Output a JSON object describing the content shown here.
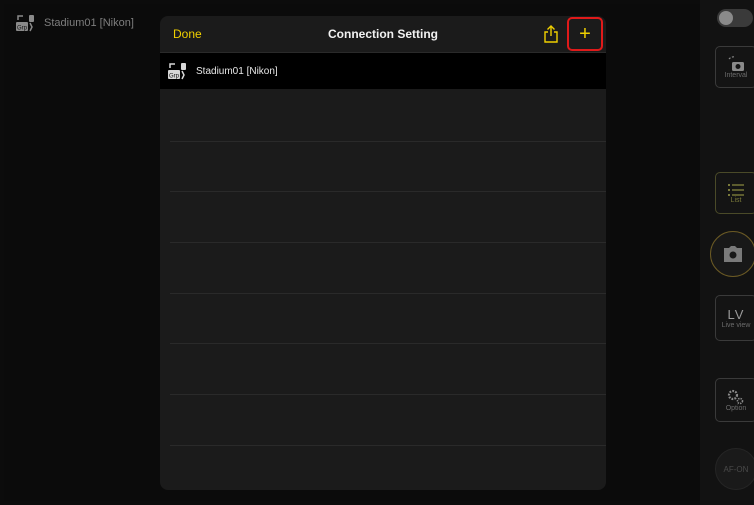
{
  "background": {
    "connection_name": "Stadium01 [Nikon]",
    "grp_badge": "Grp"
  },
  "modal": {
    "done_label": "Done",
    "title": "Connection Setting",
    "add_label": "+",
    "rows": [
      {
        "badge": "Grp",
        "label": "Stadium01 [Nikon]",
        "selected": true
      }
    ]
  },
  "rail": {
    "interval_label": "Interval",
    "list_label": "List",
    "lv_label": "LV",
    "liveview_label": "Live view",
    "option_label": "Option",
    "afon_label": "AF-ON"
  },
  "colors": {
    "accent": "#f0d000",
    "highlight": "#e01a1a",
    "modal_bg": "#1b1b1b"
  }
}
